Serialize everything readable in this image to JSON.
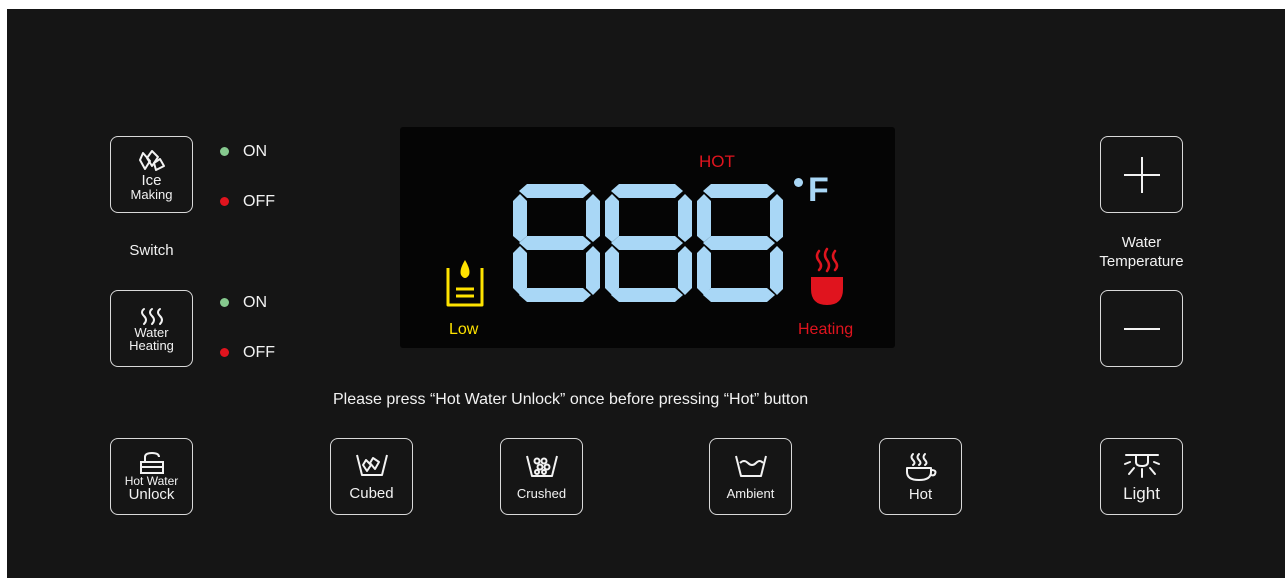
{
  "colors": {
    "panel_bg": "#151515",
    "digit_blue": "#a9d7f6",
    "led_green": "#86c98e",
    "led_red": "#e0141e",
    "warn_yellow": "#ffe300",
    "heat_red": "#e0141e"
  },
  "left_controls": {
    "ice_making": {
      "line1": "Ice",
      "line2": "Making",
      "icon": "ice-icon"
    },
    "water_heating": {
      "line1": "Water",
      "line2": "Heating",
      "icon": "heat-waves-icon"
    },
    "switch_label": "Switch",
    "on_label": "ON",
    "off_label": "OFF"
  },
  "display": {
    "hot_label": "HOT",
    "digits": "888",
    "unit": "F",
    "low_label": "Low",
    "heating_label": "Heating"
  },
  "right_controls": {
    "plus": "+",
    "minus": "—",
    "water_temp_line1": "Water",
    "water_temp_line2": "Temperature"
  },
  "notice": "Please press “Hot Water Unlock” once before pressing “Hot” button",
  "bottom_buttons": {
    "hot_water_unlock_line1": "Hot Water",
    "hot_water_unlock_line2": "Unlock",
    "cubed": "Cubed",
    "crushed": "Crushed",
    "ambient": "Ambient",
    "hot": "Hot",
    "light": "Light"
  }
}
